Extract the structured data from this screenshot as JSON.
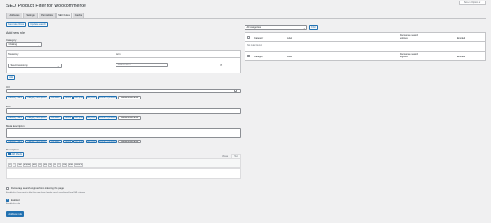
{
  "screen_options": "Screen Options ▾",
  "page_title": "SEO Product Filter for Woocommerce",
  "tabs": [
    {
      "label": "Attributes"
    },
    {
      "label": "Settings"
    },
    {
      "label": "Permalinks"
    },
    {
      "label": "SEO Rules"
    },
    {
      "label": "Cache"
    }
  ],
  "top_buttons": {
    "generate": "Generate Rules",
    "update": "Update search"
  },
  "form": {
    "heading": "Add new rule",
    "category_label": "Category",
    "category_value": "Clothing",
    "taxonomy_header": "Taxonomy",
    "term_header": "Term",
    "taxonomy_select": "Select taxonomy",
    "term_placeholder": "Search term",
    "remove_icon": "×",
    "add_button": "Add",
    "url_label": "Url",
    "title_label": "Title",
    "meta_label": "Meta description",
    "description_label": "Description",
    "add_media": "Add Media",
    "visual_tab": "Visual",
    "text_tab": "Text",
    "quicktags": [
      "b",
      "i",
      "link",
      "b-quote",
      "del",
      "ins",
      "img",
      "ul",
      "ol",
      "li",
      "code",
      "more",
      "close tags"
    ],
    "noindex_label": "Discourage search engines from indexing this page",
    "noindex_help": "Enable this if you want to hide this page from Google search results and from XML sitemap",
    "enabled_label": "Enabled",
    "enabled_help": "Enable this rule",
    "submit": "Add new rule"
  },
  "variable_buttons": [
    "Category name",
    "Category description",
    "Attributes",
    "Brands",
    "Min price",
    "Max price",
    "Number of products",
    "Add attribute name"
  ],
  "list": {
    "filter_select": "All categories",
    "filter_button": "Filter",
    "columns": [
      "Category",
      "Label",
      "Discourage search engines",
      "Enabled"
    ],
    "empty_text": "No rules found."
  },
  "colors": {
    "accent": "#2271b1",
    "background": "#f0f0f1",
    "border": "#c3c4c7"
  }
}
